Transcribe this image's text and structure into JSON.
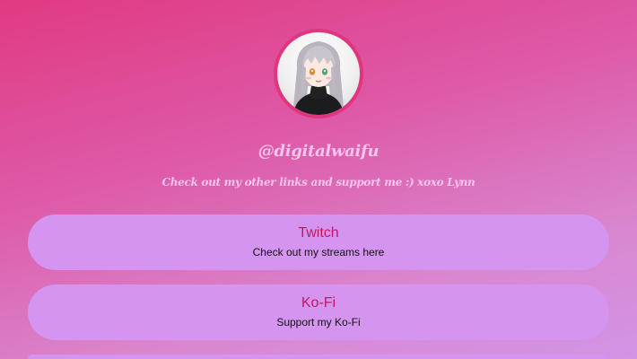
{
  "profile": {
    "handle": "@digitalwaifu",
    "bio": "Check out my other links and support me :) xoxo Lynn",
    "avatar_icon": "avatar-illustration"
  },
  "links": [
    {
      "title": "Twitch",
      "subtitle": "Check out my streams here"
    },
    {
      "title": "Ko-Fi",
      "subtitle": "Support my Ko-Fi"
    },
    {
      "title": "",
      "subtitle": ""
    }
  ],
  "colors": {
    "accent": "#e0357f",
    "card": "#d494ef",
    "title_text": "#c2185f",
    "handle_text": "#f7c5ec"
  }
}
